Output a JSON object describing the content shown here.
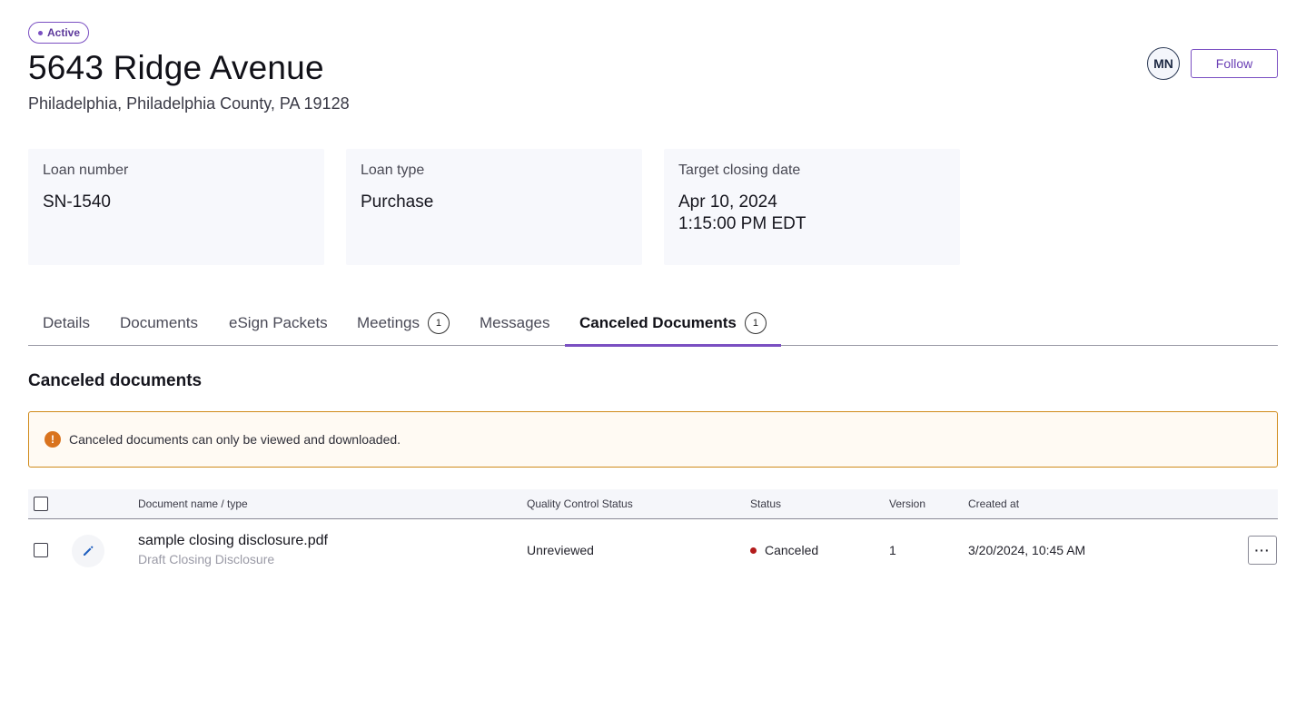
{
  "header": {
    "status_badge": "Active",
    "title": "5643 Ridge Avenue",
    "subtitle": "Philadelphia, Philadelphia County, PA 19128",
    "avatar_initials": "MN",
    "follow_label": "Follow"
  },
  "cards": [
    {
      "label": "Loan number",
      "value": "SN-1540"
    },
    {
      "label": "Loan type",
      "value": "Purchase"
    },
    {
      "label": "Target closing date",
      "value_line1": "Apr 10, 2024",
      "value_line2": "1:15:00 PM EDT"
    }
  ],
  "tabs": [
    {
      "label": "Details"
    },
    {
      "label": "Documents"
    },
    {
      "label": "eSign Packets"
    },
    {
      "label": "Meetings",
      "count": "1"
    },
    {
      "label": "Messages"
    },
    {
      "label": "Canceled Documents",
      "count": "1",
      "active": true
    }
  ],
  "section": {
    "title": "Canceled documents",
    "alert_text": "Canceled documents can only be viewed and downloaded."
  },
  "table": {
    "columns": {
      "name": "Document name / type",
      "qc": "Quality Control Status",
      "status": "Status",
      "version": "Version",
      "created": "Created at"
    },
    "rows": [
      {
        "name": "sample closing disclosure.pdf",
        "type": "Draft Closing Disclosure",
        "qc": "Unreviewed",
        "status": "Canceled",
        "version": "1",
        "created": "3/20/2024, 10:45 AM"
      }
    ]
  },
  "colors": {
    "accent": "#7a4fc2",
    "warning": "#d9731e",
    "canceled": "#b31b1b"
  },
  "icons": {
    "alert": "exclamation-circle-icon",
    "row_edit": "pencil-icon",
    "row_more": "more-horizontal-icon"
  }
}
